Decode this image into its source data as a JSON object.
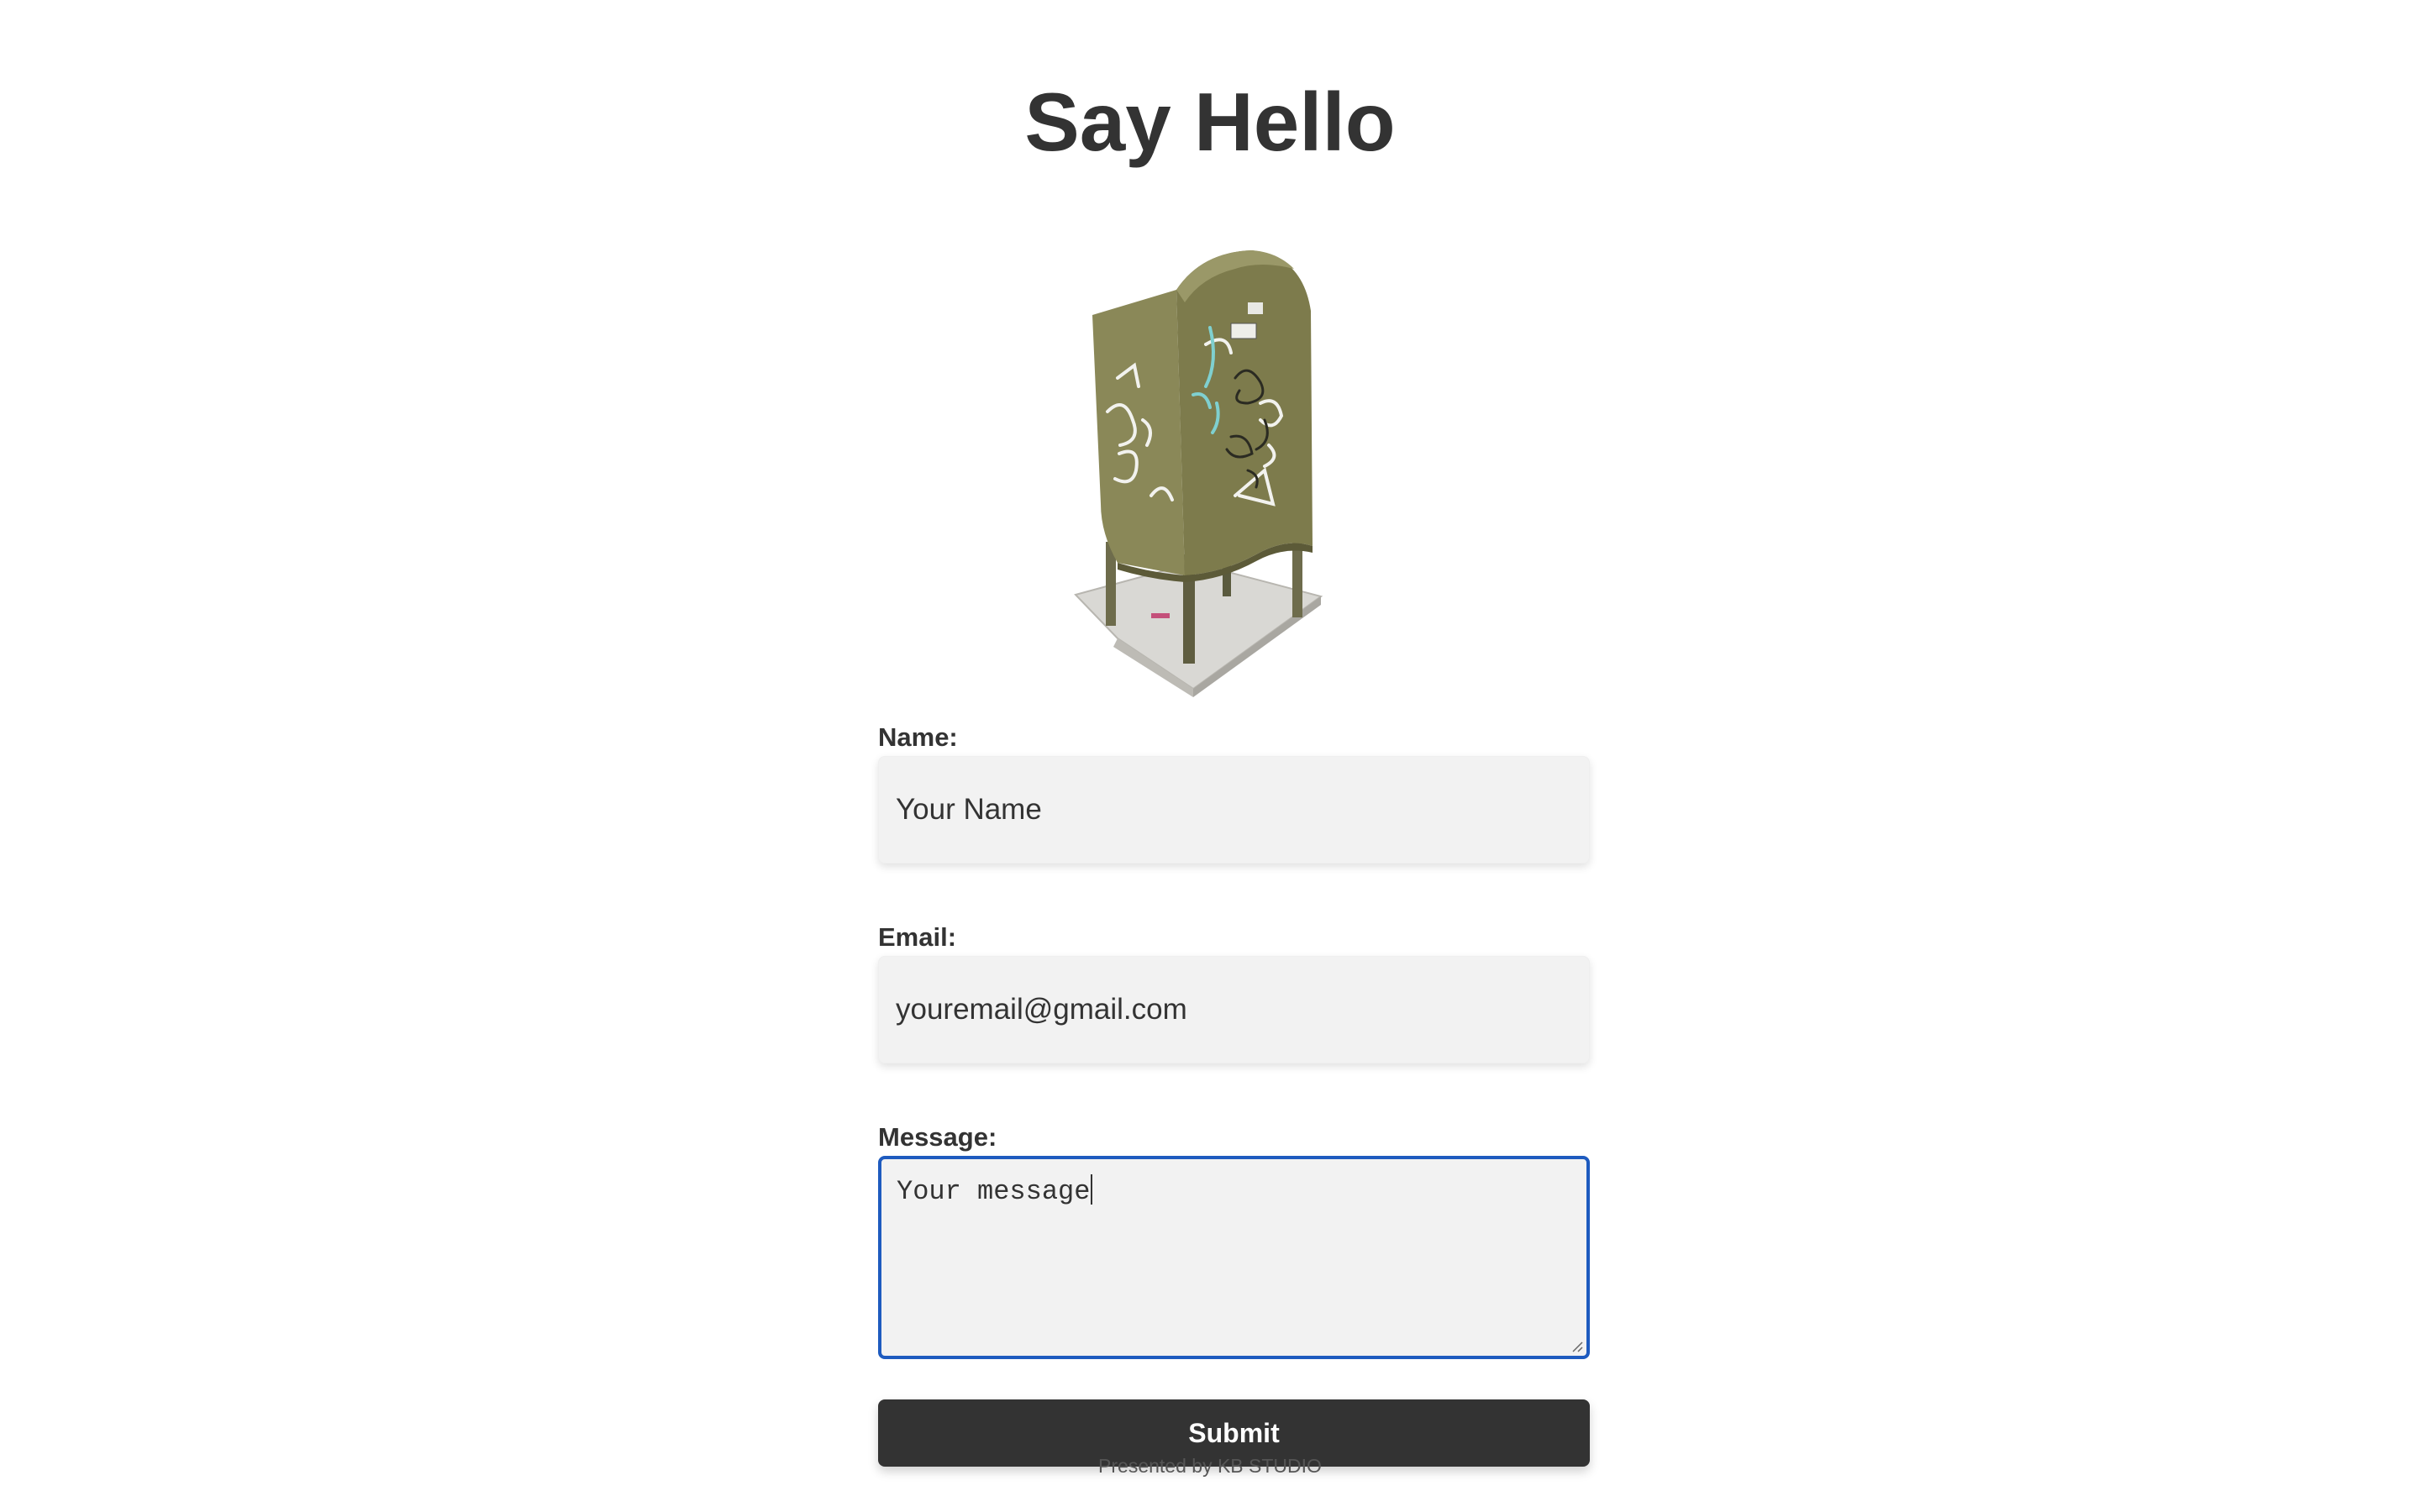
{
  "page": {
    "title": "Say Hello",
    "image": {
      "alt": "",
      "icon": "mailbox-image"
    }
  },
  "form": {
    "name_label": "Name:",
    "name_value": "Your Name",
    "email_label": "Email:",
    "email_value": "youremail@gmail.com",
    "message_label": "Message:",
    "message_value": "Your message",
    "submit_label": "Submit"
  },
  "footer": {
    "text": "Presented by KB STUDIO"
  },
  "colors": {
    "text": "#333333",
    "field_bg": "#f2f2f2",
    "focus_border": "#1e5bbf",
    "button_bg": "#333333",
    "button_text": "#ffffff"
  }
}
